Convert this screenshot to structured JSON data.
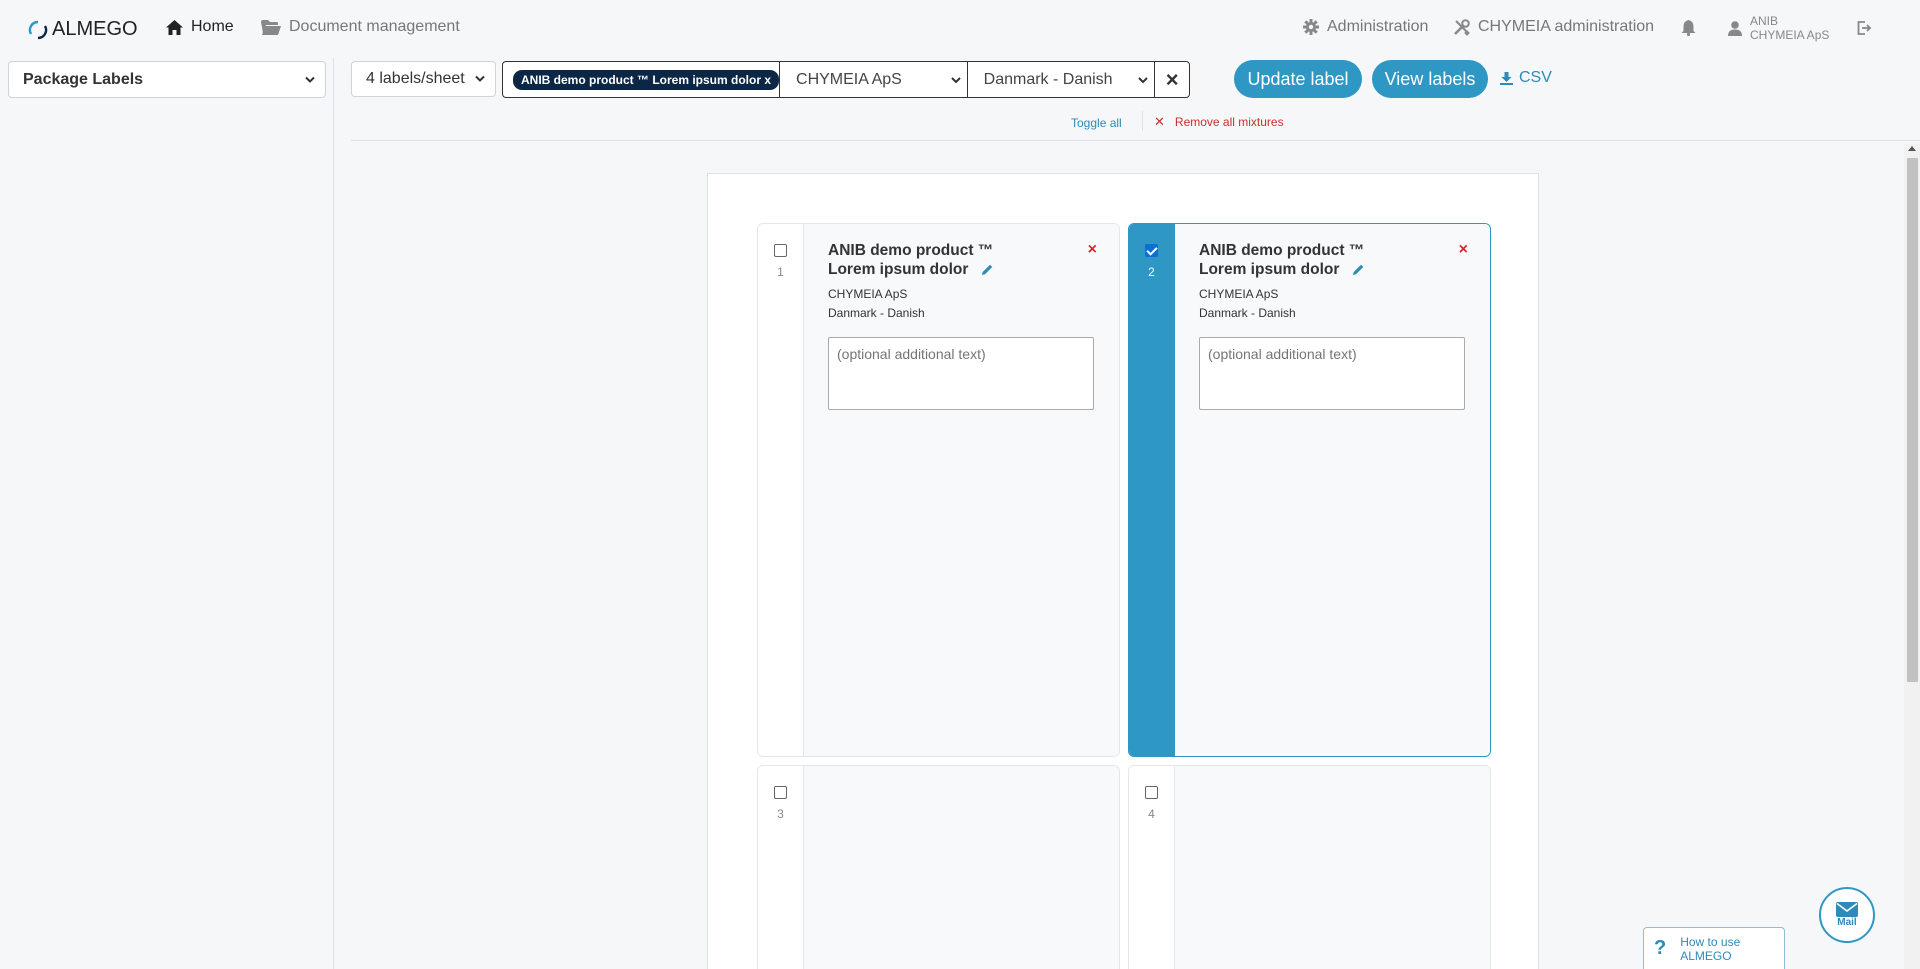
{
  "nav": {
    "brand": "ALMEGO",
    "home": "Home",
    "document_management": "Document management",
    "administration": "Administration",
    "chymeia_administration": "CHYMEIA administration",
    "user_name": "ANIB",
    "user_company": "CHYMEIA ApS"
  },
  "sidebar": {
    "section_select": "Package Labels"
  },
  "toolbar": {
    "labels_per_sheet": "4 labels/sheet",
    "product_chip": "ANIB demo product ™ Lorem ipsum dolor x",
    "company_select": "CHYMEIA ApS",
    "language_select": "Danmark - Danish",
    "clear": "×",
    "update_label": "Update label",
    "view_labels": "View labels",
    "csv": "CSV",
    "toggle_all": "Toggle all",
    "remove_all_mixtures": "Remove all mixtures"
  },
  "labels": [
    {
      "number": "1",
      "checked": false,
      "title": "ANIB demo product ™ Lorem ipsum dolor",
      "company": "CHYMEIA ApS",
      "language": "Danmark - Danish",
      "placeholder": "(optional additional text)",
      "remove": "×"
    },
    {
      "number": "2",
      "checked": true,
      "title": "ANIB demo product ™ Lorem ipsum dolor",
      "company": "CHYMEIA ApS",
      "language": "Danmark - Danish",
      "placeholder": "(optional additional text)",
      "remove": "×"
    },
    {
      "number": "3",
      "checked": false
    },
    {
      "number": "4",
      "checked": false
    }
  ],
  "help": {
    "how_to_use": "How to use ALMEGO",
    "mail": "Mail"
  },
  "colors": {
    "accent": "#2e97c4",
    "chip": "#0c2745",
    "danger": "#d9272e"
  }
}
